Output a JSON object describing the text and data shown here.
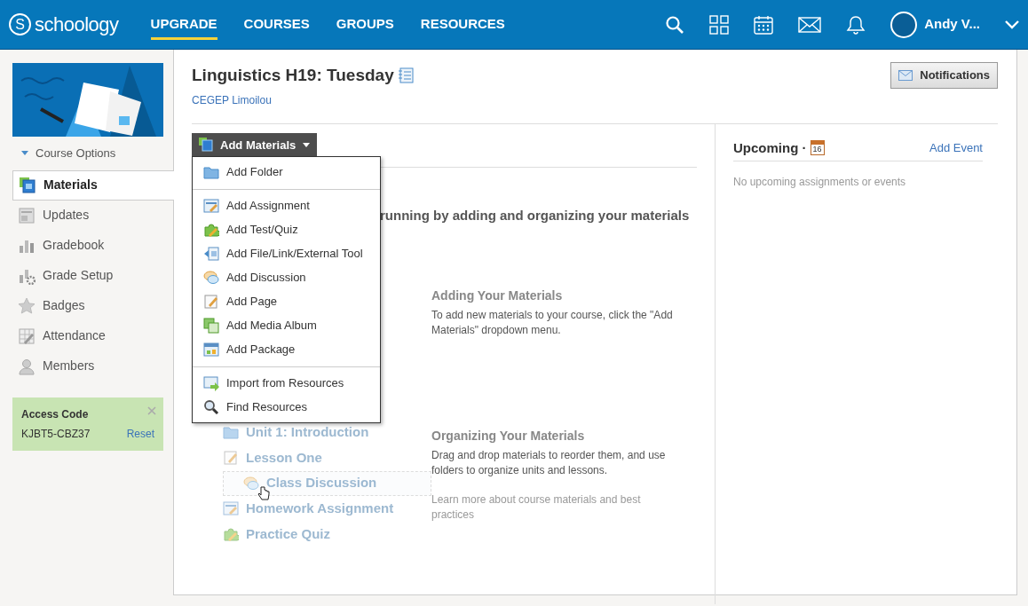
{
  "nav": {
    "logo_letter": "S",
    "logo": "schoology",
    "items": [
      {
        "label": "UPGRADE",
        "selected": true
      },
      {
        "label": "COURSES",
        "selected": false
      },
      {
        "label": "GROUPS",
        "selected": false
      },
      {
        "label": "RESOURCES",
        "selected": false
      }
    ],
    "user": "Andy V..."
  },
  "sidebar": {
    "course_options": "Course Options",
    "items": [
      {
        "label": "Materials",
        "kind": "materials",
        "selected": true
      },
      {
        "label": "Updates",
        "kind": "updates",
        "selected": false
      },
      {
        "label": "Gradebook",
        "kind": "gradebook",
        "selected": false
      },
      {
        "label": "Grade Setup",
        "kind": "gradesetup",
        "selected": false
      },
      {
        "label": "Badges",
        "kind": "badges",
        "selected": false
      },
      {
        "label": "Attendance",
        "kind": "attendance",
        "selected": false
      },
      {
        "label": "Members",
        "kind": "members",
        "selected": false
      }
    ],
    "access_code": {
      "title": "Access Code",
      "code": "KJBT5-CBZ37",
      "action": "Reset"
    }
  },
  "course": {
    "title": "Linguistics H19: Tuesday",
    "school": "CEGEP Limoilou"
  },
  "notifications_button": "Notifications",
  "add_materials": {
    "label": "Add Materials",
    "menu": [
      [
        {
          "label": "Add Folder",
          "kind": "folder"
        }
      ],
      [
        {
          "label": "Add Assignment",
          "kind": "assignment"
        },
        {
          "label": "Add Test/Quiz",
          "kind": "quiz"
        },
        {
          "label": "Add File/Link/External Tool",
          "kind": "file"
        },
        {
          "label": "Add Discussion",
          "kind": "discussion"
        },
        {
          "label": "Add Page",
          "kind": "page"
        },
        {
          "label": "Add Media Album",
          "kind": "album"
        },
        {
          "label": "Add Package",
          "kind": "package"
        }
      ],
      [
        {
          "label": "Import from Resources",
          "kind": "import"
        },
        {
          "label": "Find Resources",
          "kind": "search"
        }
      ]
    ]
  },
  "empty_state": {
    "heading": "running by adding and organizing your materials",
    "sections": [
      {
        "title": "Adding Your Materials",
        "text": "To add new materials to your course, click the \"Add Materials\" dropdown menu."
      },
      {
        "title": "Organizing Your Materials",
        "text": "Drag and drop materials to reorder them, and use folders to organize units and lessons.",
        "link": "Learn more about course materials and best practices"
      }
    ],
    "example_list": [
      {
        "label": "Unit 1: Introduction",
        "kind": "folder",
        "dragging": false
      },
      {
        "label": "Lesson One",
        "kind": "page",
        "dragging": false
      },
      {
        "label": "Class Discussion",
        "kind": "discussion",
        "dragging": true
      },
      {
        "label": "Homework Assignment",
        "kind": "assignment",
        "dragging": false
      },
      {
        "label": "Practice Quiz",
        "kind": "quiz",
        "dragging": false
      }
    ]
  },
  "upcoming": {
    "title": "Upcoming ·",
    "calendar_day": "16",
    "action": "Add Event",
    "empty": "No upcoming assignments or events"
  }
}
